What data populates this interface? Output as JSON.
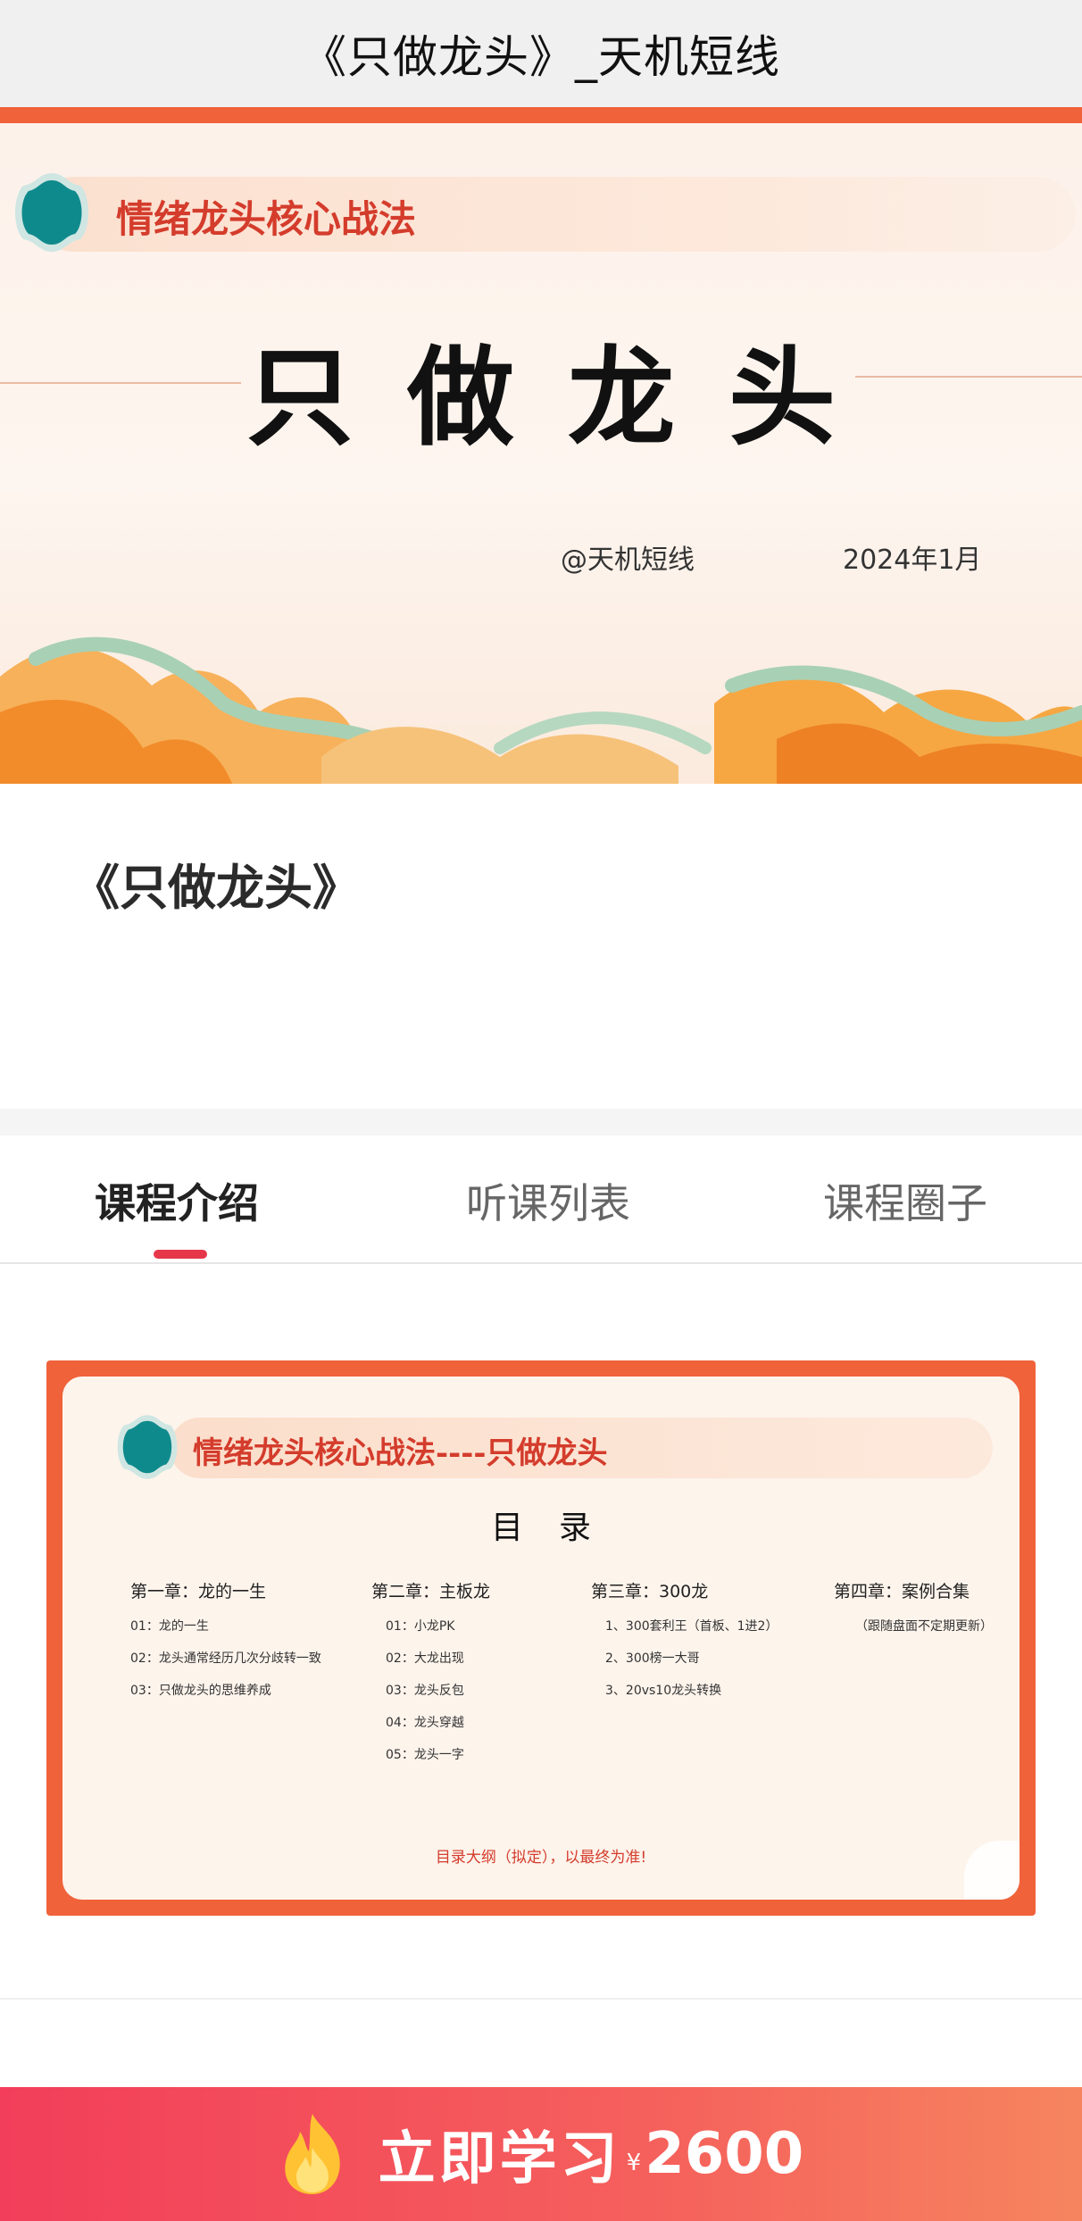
{
  "header": {
    "title": "《只做龙头》_天机短线"
  },
  "hero": {
    "pill_text": "情绪龙头核心战法",
    "big_title": "只做龙头",
    "author": "@天机短线",
    "date": "2024年1月"
  },
  "course": {
    "name": "《只做龙头》"
  },
  "tabs": [
    {
      "label": "课程介绍",
      "active": true
    },
    {
      "label": "听课列表",
      "active": false
    },
    {
      "label": "课程圈子",
      "active": false
    }
  ],
  "toc": {
    "pill_text": "情绪龙头核心战法----只做龙头",
    "heading": "目录",
    "chapters": [
      {
        "title": "第一章：龙的一生",
        "items": [
          "01：龙的一生",
          "02：龙头通常经历几次分歧转一致",
          "03：只做龙头的思维养成"
        ]
      },
      {
        "title": "第二章：主板龙",
        "items": [
          "01：小龙PK",
          "02：大龙出现",
          "03：龙头反包",
          "04：龙头穿越",
          "05：龙头一字"
        ]
      },
      {
        "title": "第三章：300龙",
        "items": [
          "1、300套利王（首板、1进2）",
          "2、300榜一大哥",
          "3、20vs10龙头转换"
        ]
      },
      {
        "title": "第四章：案例合集",
        "items": [
          "（跟随盘面不定期更新）"
        ]
      }
    ],
    "note": "目录大纲（拟定），以最终为准!"
  },
  "buy": {
    "label": "立即学习",
    "currency": "¥",
    "price": "2600",
    "accent_colors": [
      "#f23e5a",
      "#f6855f"
    ]
  },
  "icons": [
    "teal-badge-icon",
    "flame-icon",
    "cloud-decoration"
  ]
}
